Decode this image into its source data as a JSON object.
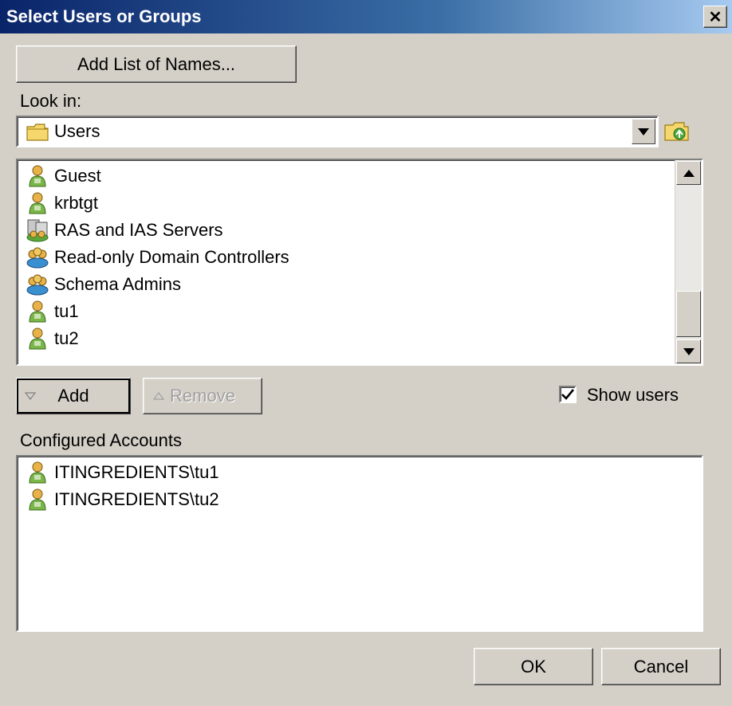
{
  "window": {
    "title": "Select Users or Groups",
    "close_label": "✕"
  },
  "add_list_button": "Add List of Names...",
  "look_in": {
    "label": "Look in:",
    "value": "Users"
  },
  "objects": [
    {
      "name": "Guest",
      "icon": "user-icon"
    },
    {
      "name": "krbtgt",
      "icon": "user-icon"
    },
    {
      "name": "RAS and IAS Servers",
      "icon": "server-group-icon"
    },
    {
      "name": "Read-only Domain Controllers",
      "icon": "group-icon"
    },
    {
      "name": "Schema Admins",
      "icon": "group-icon"
    },
    {
      "name": "tu1",
      "icon": "user-icon"
    },
    {
      "name": "tu2",
      "icon": "user-icon"
    }
  ],
  "add_button": "Add",
  "remove_button": "Remove",
  "show_users": {
    "label": "Show users",
    "checked": true
  },
  "configured_accounts": {
    "label": "Configured Accounts",
    "items": [
      {
        "name": "ITINGREDIENTS\\tu1",
        "icon": "user-icon"
      },
      {
        "name": "ITINGREDIENTS\\tu2",
        "icon": "user-icon"
      }
    ]
  },
  "ok_button": "OK",
  "cancel_button": "Cancel",
  "colors": {
    "title_bar": "#0a246a",
    "dialog_bg": "#d4d0c8",
    "list_bg": "#ffffff"
  }
}
